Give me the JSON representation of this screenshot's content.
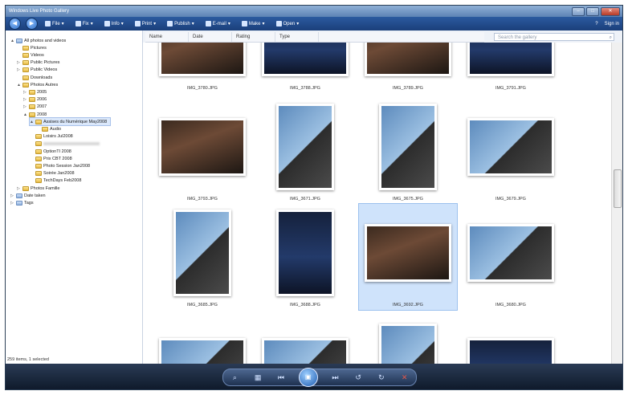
{
  "app": {
    "title": "Windows Live Photo Gallery"
  },
  "toolbar": {
    "items": [
      {
        "label": "File",
        "icon": "file-icon"
      },
      {
        "label": "Fix",
        "icon": "fix-icon"
      },
      {
        "label": "Info",
        "icon": "info-icon"
      },
      {
        "label": "Print",
        "icon": "print-icon"
      },
      {
        "label": "Publish",
        "icon": "publish-icon"
      },
      {
        "label": "E-mail",
        "icon": "email-icon"
      },
      {
        "label": "Make",
        "icon": "make-icon"
      },
      {
        "label": "Open",
        "icon": "open-icon"
      }
    ],
    "sign_in": "Sign in"
  },
  "columns": [
    "Name",
    "Date",
    "Rating",
    "Type"
  ],
  "search": {
    "placeholder": "Search the gallery"
  },
  "tree": [
    {
      "label": "All photos and videos",
      "indent": 0,
      "toggle": "▲",
      "kind": "sys"
    },
    {
      "label": "Pictures",
      "indent": 1,
      "toggle": "",
      "kind": "folder"
    },
    {
      "label": "Videos",
      "indent": 1,
      "toggle": "",
      "kind": "folder"
    },
    {
      "label": "Public Pictures",
      "indent": 1,
      "toggle": "▷",
      "kind": "folder"
    },
    {
      "label": "Public Videos",
      "indent": 1,
      "toggle": "▷",
      "kind": "folder"
    },
    {
      "label": "Downloads",
      "indent": 1,
      "toggle": "",
      "kind": "folder"
    },
    {
      "label": "Photos Autres",
      "indent": 1,
      "toggle": "▲",
      "kind": "folder"
    },
    {
      "label": "2005",
      "indent": 2,
      "toggle": "▷",
      "kind": "folder"
    },
    {
      "label": "2006",
      "indent": 2,
      "toggle": "▷",
      "kind": "folder"
    },
    {
      "label": "2007",
      "indent": 2,
      "toggle": "▷",
      "kind": "folder"
    },
    {
      "label": "2008",
      "indent": 2,
      "toggle": "▲",
      "kind": "folder"
    },
    {
      "label": "Assises du Numérique May2008",
      "indent": 3,
      "toggle": "▲",
      "kind": "folder",
      "selected": true
    },
    {
      "label": "Audio",
      "indent": 4,
      "toggle": "",
      "kind": "folder"
    },
    {
      "label": "Loisirs Jul2008",
      "indent": 3,
      "toggle": "",
      "kind": "folder"
    },
    {
      "label": "",
      "indent": 3,
      "toggle": "",
      "kind": "folder",
      "blurred": true
    },
    {
      "label": "OptionTI 2008",
      "indent": 3,
      "toggle": "",
      "kind": "folder"
    },
    {
      "label": "Prix CBT 2008",
      "indent": 3,
      "toggle": "",
      "kind": "folder"
    },
    {
      "label": "Photo Session Jan2008",
      "indent": 3,
      "toggle": "",
      "kind": "folder"
    },
    {
      "label": "Soirée Jan2008",
      "indent": 3,
      "toggle": "",
      "kind": "folder"
    },
    {
      "label": "TechDays Feb2008",
      "indent": 3,
      "toggle": "",
      "kind": "folder"
    },
    {
      "label": "Photos Famille",
      "indent": 1,
      "toggle": "▷",
      "kind": "folder"
    },
    {
      "label": "Date taken",
      "indent": 0,
      "toggle": "▷",
      "kind": "sys"
    },
    {
      "label": "Tags",
      "indent": 0,
      "toggle": "▷",
      "kind": "sys"
    }
  ],
  "status": "259 items, 1 selected",
  "photos": [
    {
      "name": "IMG_3780.JPG",
      "scene": "crowd"
    },
    {
      "name": "IMG_3788.JPG",
      "scene": "stage"
    },
    {
      "name": "IMG_3789.JPG",
      "scene": "crowd"
    },
    {
      "name": "IMG_3791.JPG",
      "scene": "stage"
    },
    {
      "name": "IMG_3793.JPG",
      "scene": "crowd"
    },
    {
      "name": "IMG_3671.JPG",
      "scene": "speaker"
    },
    {
      "name": "IMG_3675.JPG",
      "scene": "speaker"
    },
    {
      "name": "IMG_3679.JPG",
      "scene": "speaker"
    },
    {
      "name": "IMG_3685.JPG",
      "scene": "speaker"
    },
    {
      "name": "IMG_3688.JPG",
      "scene": "stage"
    },
    {
      "name": "IMG_3692.JPG",
      "scene": "crowd",
      "selected": true
    },
    {
      "name": "IMG_3680.JPG",
      "scene": "speaker"
    },
    {
      "name": "",
      "scene": "speaker"
    },
    {
      "name": "",
      "scene": "speaker"
    },
    {
      "name": "",
      "scene": "speaker"
    },
    {
      "name": "",
      "scene": "stage"
    }
  ],
  "colors": {
    "toolbar": "#1b3f7a",
    "selection": "#cfe3fb",
    "bottom_bar": "#0f1a2b"
  }
}
